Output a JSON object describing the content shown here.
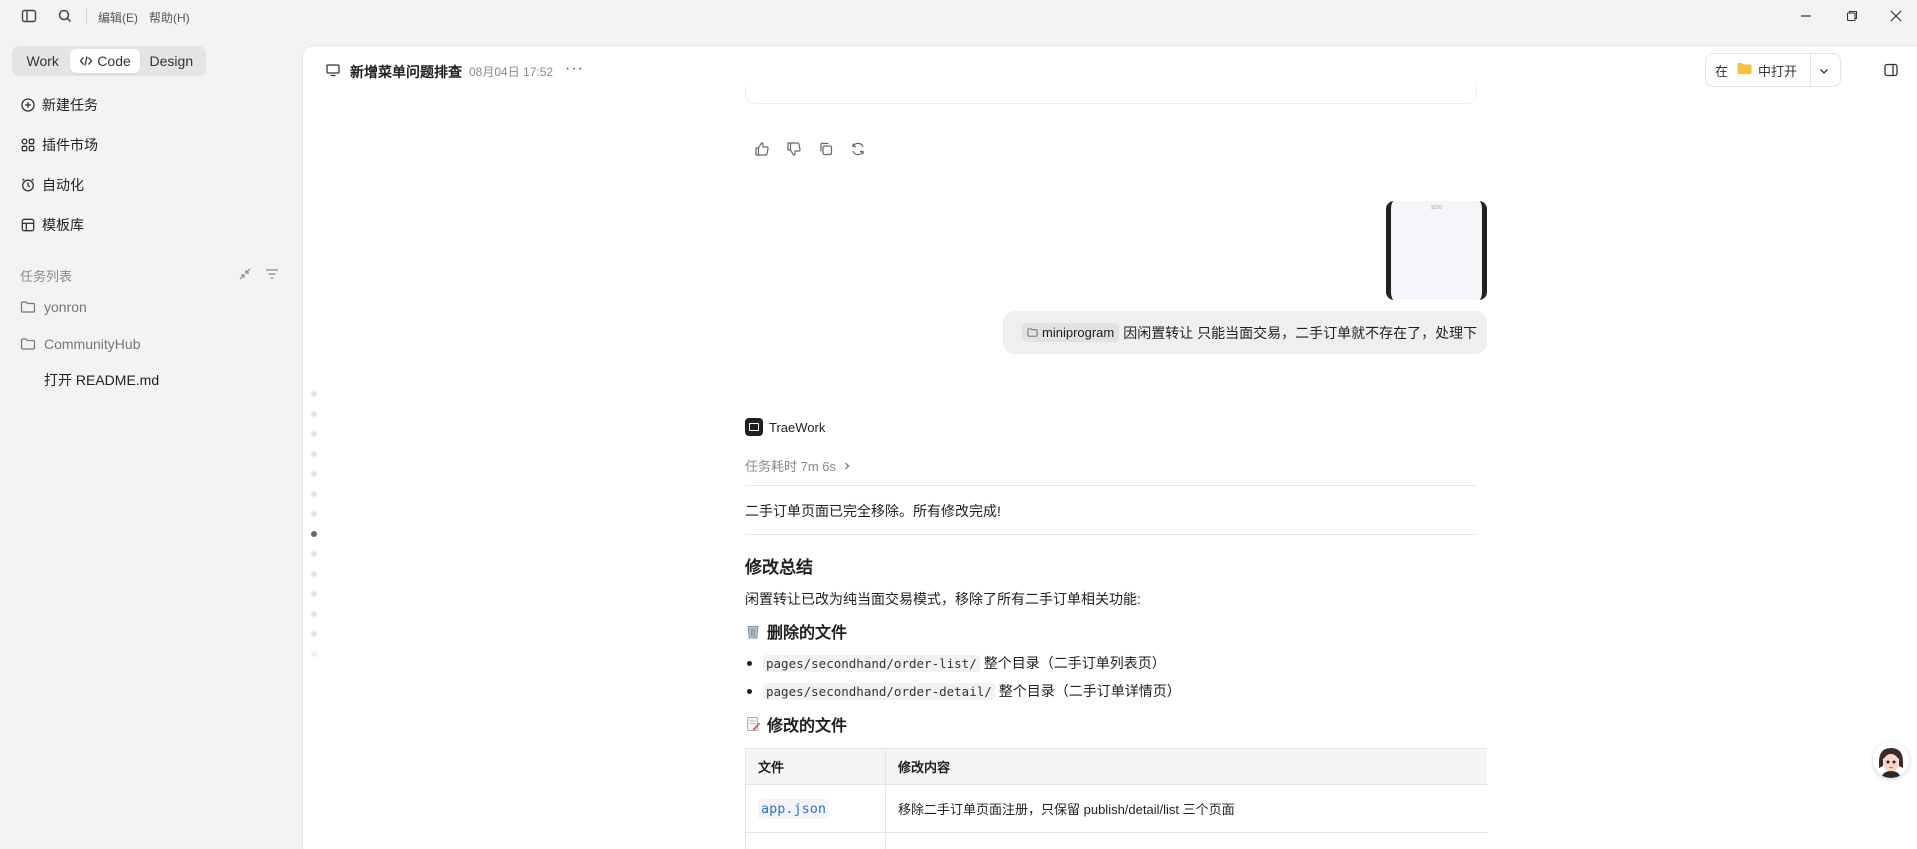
{
  "titlebar": {
    "menu": [
      "编辑(E)",
      "帮助(H)"
    ]
  },
  "sidebar": {
    "modes": [
      "Work",
      "Code",
      "Design"
    ],
    "active_mode": "Code",
    "nav": [
      {
        "label": "新建任务",
        "icon": "plus-circle-icon"
      },
      {
        "label": "插件市场",
        "icon": "plugins-icon"
      },
      {
        "label": "自动化",
        "icon": "alarm-clock-icon"
      },
      {
        "label": "模板库",
        "icon": "template-icon"
      }
    ],
    "task_list_title": "任务列表",
    "folders": [
      "yonron",
      "CommunityHub"
    ],
    "open_file": "打开 README.md"
  },
  "header": {
    "title": "新增菜单问题排查",
    "date": "08月04日 17:52",
    "more": "···",
    "open_in_prefix": "在",
    "open_in_label": "中打开"
  },
  "chat": {
    "thumb_caption": "$326",
    "user_message": {
      "chip": "miniprogram",
      "text": "因闲置转让 只能当面交易，二手订单就不存在了，处理下"
    },
    "agent_name": "TraeWork",
    "task_time": "任务耗时 7m 6s",
    "done_text": "二手订单页面已完全移除。所有修改完成!",
    "summary_title": "修改总结",
    "summary_text": "闲置转让已改为纯当面交易模式，移除了所有二手订单相关功能:",
    "deleted_title": "删除的文件",
    "deleted_items": [
      {
        "code": "pages/secondhand/order-list/",
        "desc": "整个目录（二手订单列表页）"
      },
      {
        "code": "pages/secondhand/order-detail/",
        "desc": "整个目录（二手订单详情页）"
      }
    ],
    "modified_title": "修改的文件",
    "table": {
      "headers": [
        "文件",
        "修改内容"
      ],
      "rows": [
        {
          "file": "app.json",
          "change": "移除二手订单页面注册，只保留 publish/detail/list 三个页面"
        }
      ]
    }
  },
  "colors": {
    "accent_link": "#2f6fd0",
    "background": "#f3f3f3",
    "panel": "#ffffff"
  }
}
